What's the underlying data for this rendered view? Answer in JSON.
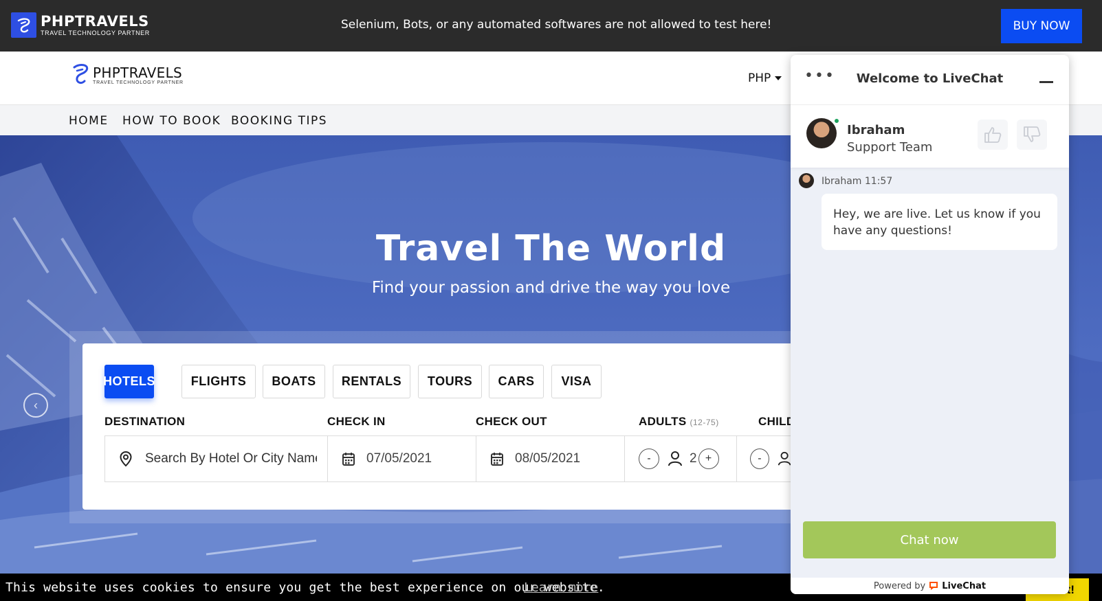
{
  "topbar": {
    "brand_name": "PHPTRAVELS",
    "brand_tagline": "TRAVEL TECHNOLOGY PARTNER",
    "warning": "Selenium, Bots, or any automated softwares are not allowed to test here!",
    "buy_now": "BUY NOW"
  },
  "header": {
    "brand_name": "PHPTRAVELS",
    "brand_tagline": "TRAVEL TECHNOLOGY PARTNER",
    "currency": "PHP"
  },
  "nav": {
    "items": [
      {
        "label": "HOME"
      },
      {
        "label": "HOW TO BOOK"
      },
      {
        "label": "BOOKING TIPS"
      }
    ]
  },
  "hero": {
    "title": "Travel The World",
    "subtitle": "Find your passion and drive the way you love"
  },
  "search": {
    "tabs": [
      {
        "label": "HOTELS",
        "active": true
      },
      {
        "label": "FLIGHTS",
        "active": false
      },
      {
        "label": "BOATS",
        "active": false
      },
      {
        "label": "RENTALS",
        "active": false
      },
      {
        "label": "TOURS",
        "active": false
      },
      {
        "label": "CARS",
        "active": false
      },
      {
        "label": "VISA",
        "active": false
      }
    ],
    "labels": {
      "destination": "DESTINATION",
      "check_in": "CHECK IN",
      "check_out": "CHECK OUT",
      "adults": "ADULTS",
      "adults_range": "(12-75)",
      "children": "CHILD"
    },
    "destination_placeholder": "Search By Hotel Or City Name",
    "check_in_value": "07/05/2021",
    "check_out_value": "08/05/2021",
    "adults_value": "2",
    "minus": "-",
    "plus": "+"
  },
  "cookie": {
    "message": "This website uses cookies to ensure you get the best experience on our website.",
    "learn_more": "Learn more",
    "got_it": "Got it!"
  },
  "livechat": {
    "menu": "•••",
    "title": "Welcome to LiveChat",
    "agent_name": "Ibraham",
    "agent_role": "Support Team",
    "message_meta": "Ibraham 11:57",
    "message": "Hey, we are live. Let us know if you have any questions!",
    "chat_now": "Chat now",
    "powered_by": "Powered by",
    "powered_brand": "LiveChat"
  },
  "colors": {
    "accent": "#0b4cf2",
    "topbar": "#2b2b2b",
    "chat_button": "#a3c75a",
    "online": "#1ea25e",
    "cookie_button": "#f1d600"
  }
}
